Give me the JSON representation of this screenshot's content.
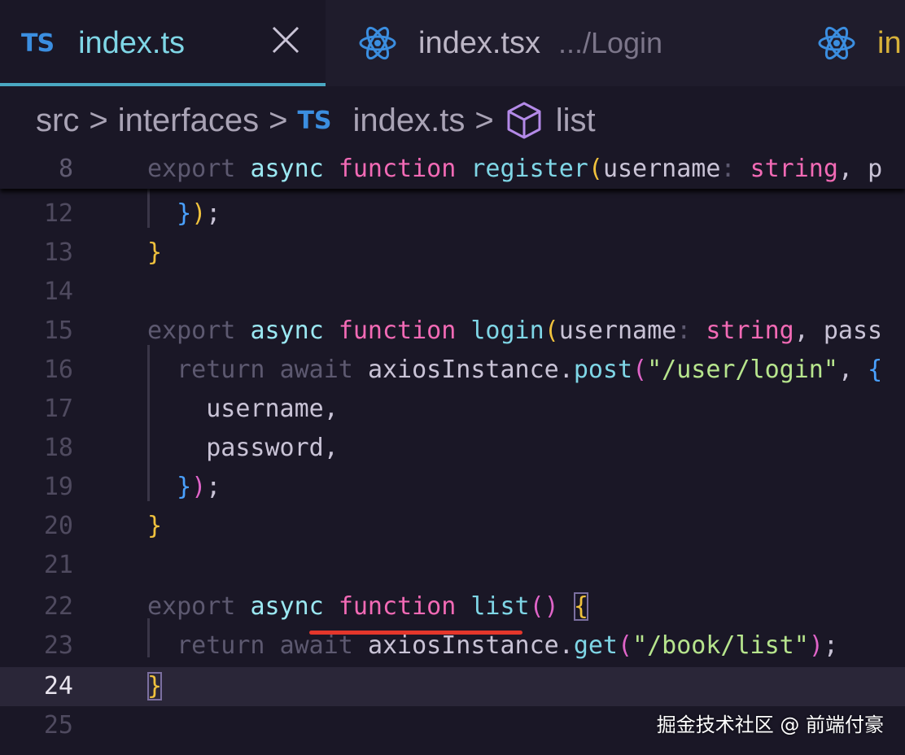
{
  "tabs": [
    {
      "badge": "TS",
      "name": "index.ts",
      "active": true
    },
    {
      "name": "index.tsx",
      "desc": ".../Login"
    },
    {
      "name": "in"
    }
  ],
  "breadcrumb": {
    "items": [
      "src",
      "interfaces",
      "index.ts",
      "list"
    ],
    "ts_badge": "TS",
    "separator": ">"
  },
  "colors": {
    "accent": "#4aa8c2",
    "keyword": "#f26ab5",
    "function": "#7fd6e6",
    "string": "#b7e58d",
    "brace": "#f0c23d"
  },
  "icons": {
    "ts": "typescript-icon",
    "react": "react-icon",
    "close": "close-icon",
    "symbol": "cube-icon"
  },
  "sticky": {
    "line": "8"
  },
  "lines": [
    {
      "n": "12"
    },
    {
      "n": "13"
    },
    {
      "n": "14"
    },
    {
      "n": "15"
    },
    {
      "n": "16"
    },
    {
      "n": "17"
    },
    {
      "n": "18"
    },
    {
      "n": "19"
    },
    {
      "n": "20"
    },
    {
      "n": "21"
    },
    {
      "n": "22"
    },
    {
      "n": "23"
    },
    {
      "n": "24"
    },
    {
      "n": "25"
    }
  ],
  "tokens": {
    "export": "export",
    "async": "async",
    "function": "function",
    "register": "register",
    "login": "login",
    "list": "list",
    "username_param": "username",
    "string_type": "string",
    "pass_cut": "pass",
    "p_cut": "p",
    "return": "return",
    "await": "await",
    "axios": "axiosInstance",
    "post": "post",
    "get": "get",
    "login_url": "\"/user/login\"",
    "list_url": "\"/book/list\"",
    "username_field": "username,",
    "password_field": "password,"
  },
  "watermark": "掘金技术社区 @ 前端付豪"
}
